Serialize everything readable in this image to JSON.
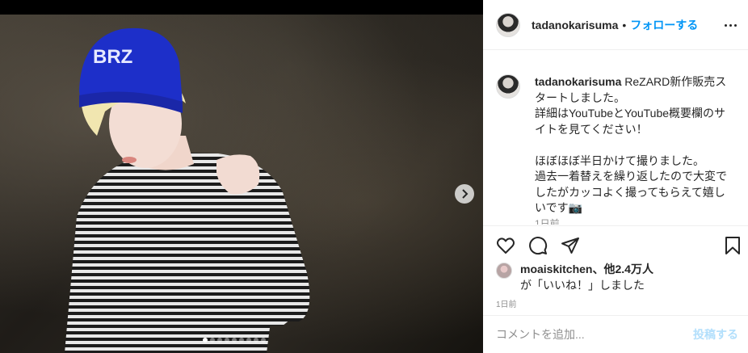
{
  "post": {
    "image": {
      "slides_total": 9,
      "active_slide": 1
    },
    "header": {
      "username": "tadanokarisuma",
      "separator": "•",
      "follow_label": "フォローする"
    },
    "caption": {
      "username": "tadanokarisuma",
      "text": " ReZARD新作販売スタートしました。\n詳細はYouTubeとYouTube概要欄のサイトを見てください！\n\nほぼほぼ半日かけて撮りました。\n過去一着替えを繰り返したので大変でしたがカッコよく撮ってもらえて嬉しいです📷",
      "time": "1日前"
    },
    "likes": {
      "user": "moaiskitchen",
      "suffix": "、他2.4万人",
      "line2": "が「いいね！」しました"
    },
    "date": "1日前",
    "comment": {
      "placeholder": "コメントを追加...",
      "post_label": "投稿する"
    },
    "icons": [
      "heart-icon",
      "comment-icon",
      "share-icon",
      "bookmark-icon",
      "more-icon",
      "chevron-right-icon"
    ],
    "colors": {
      "link": "#0095f6",
      "post_disabled": "#b2dffc",
      "beanie": "#1d2fc9"
    }
  }
}
